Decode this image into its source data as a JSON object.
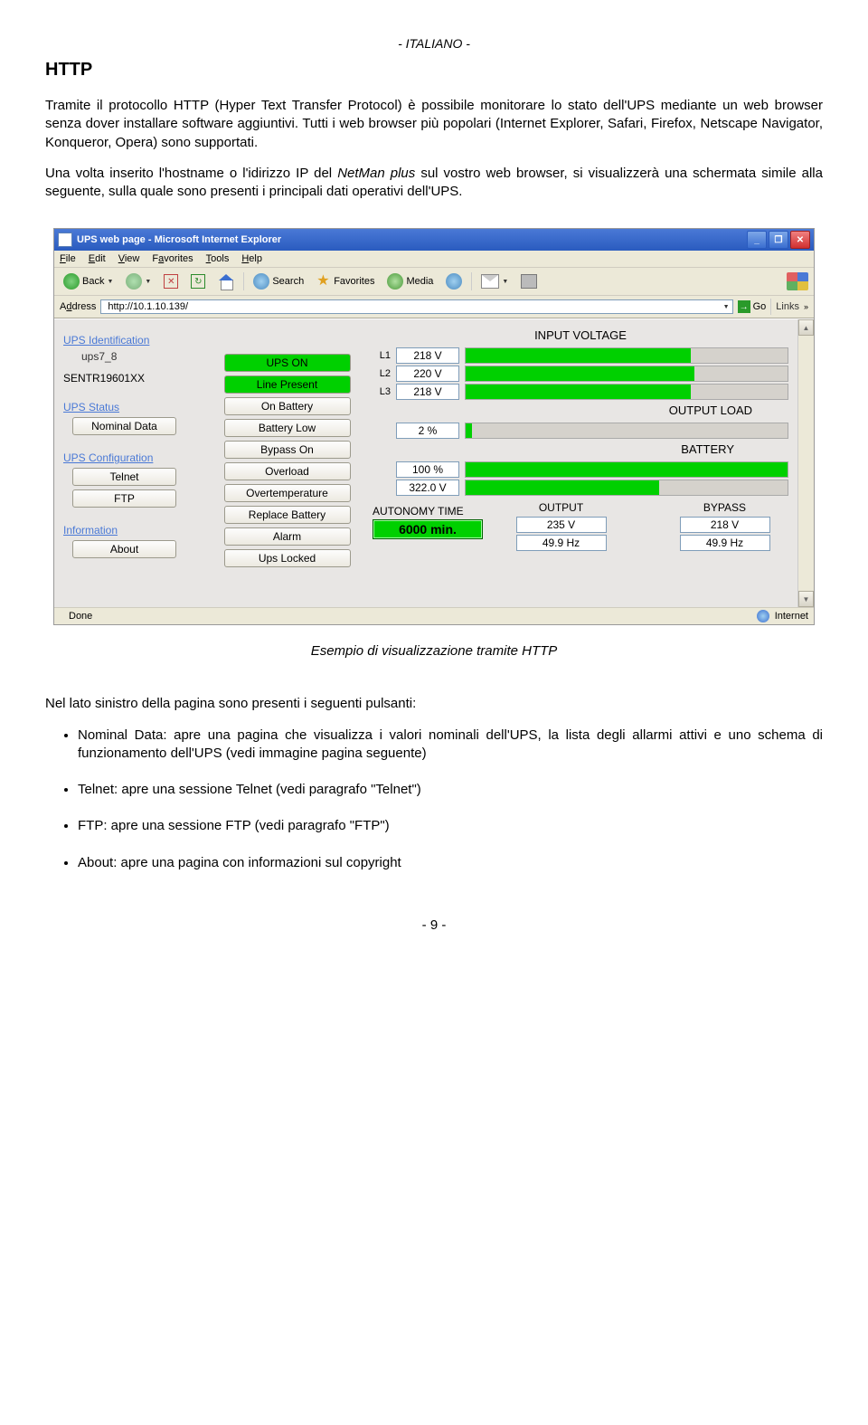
{
  "doc": {
    "lang_tag": "- ITALIANO -",
    "h1": "HTTP",
    "para1a": "Tramite il protocollo HTTP (Hyper Text Transfer Protocol) è possibile monitorare lo stato dell'UPS mediante un web browser senza dover installare software aggiuntivi. Tutti i web browser più popolari (Internet Explorer, Safari, Firefox, Netscape Navigator, Konqueror, Opera) sono supportati.",
    "para1b_a": "Una volta inserito l'hostname o l'idirizzo IP del ",
    "para1b_em": "NetMan plus",
    "para1b_b": " sul vostro web browser, si visualizzerà una schermata simile alla seguente, sulla quale sono presenti i principali dati operativi dell'UPS.",
    "caption": "Esempio di visualizzazione tramite HTTP",
    "para2": "Nel lato sinistro della pagina sono presenti i seguenti pulsanti:",
    "bul1": "Nominal Data: apre una pagina che visualizza i valori nominali dell'UPS, la lista degli allarmi attivi e uno schema di funzionamento dell'UPS (vedi immagine pagina seguente)",
    "bul2": "Telnet: apre una sessione Telnet (vedi paragrafo \"Telnet\")",
    "bul3": "FTP: apre una sessione FTP (vedi paragrafo \"FTP\")",
    "bul4": "About: apre una pagina con informazioni sul copyright",
    "pagenum": "- 9 -"
  },
  "shot": {
    "title": "UPS web page - Microsoft Internet Explorer",
    "menu": {
      "file": "File",
      "edit": "Edit",
      "view": "View",
      "favorites": "Favorites",
      "tools": "Tools",
      "help": "Help"
    },
    "tool": {
      "back": "Back",
      "search": "Search",
      "favorites": "Favorites",
      "media": "Media"
    },
    "addr": {
      "label": "Address",
      "url": "http://10.1.10.139/",
      "go": "Go",
      "links": "Links"
    },
    "left": {
      "id_hdr": "UPS Identification",
      "id_val": "ups7_8",
      "serial": "SENTR19601XX",
      "status_hdr": "UPS Status",
      "btn_nominal": "Nominal Data",
      "cfg_hdr": "UPS Configuration",
      "btn_telnet": "Telnet",
      "btn_ftp": "FTP",
      "info_hdr": "Information",
      "btn_about": "About"
    },
    "mid": {
      "items": [
        {
          "label": "UPS ON",
          "green": true
        },
        {
          "label": "Line Present",
          "green": true
        },
        {
          "label": "On Battery",
          "green": false
        },
        {
          "label": "Battery Low",
          "green": false
        },
        {
          "label": "Bypass On",
          "green": false
        },
        {
          "label": "Overload",
          "green": false
        },
        {
          "label": "Overtemperature",
          "green": false
        },
        {
          "label": "Replace Battery",
          "green": false
        },
        {
          "label": "Alarm",
          "green": false
        },
        {
          "label": "Ups Locked",
          "green": false
        }
      ]
    },
    "right": {
      "input_title": "INPUT VOLTAGE",
      "phases": [
        {
          "label": "L1",
          "value": "218 V",
          "pct": 70
        },
        {
          "label": "L2",
          "value": "220 V",
          "pct": 71
        },
        {
          "label": "L3",
          "value": "218 V",
          "pct": 70
        }
      ],
      "load_title": "OUTPUT LOAD",
      "load": {
        "value": "2 %",
        "pct": 2
      },
      "batt_title": "BATTERY",
      "batt_pct": {
        "value": "100 %",
        "pct": 100
      },
      "batt_v": {
        "value": "322.0 V",
        "pct": 60
      },
      "auton_title": "AUTONOMY TIME",
      "auton_val": "6000 min.",
      "output_title": "OUTPUT",
      "output_v": "235 V",
      "output_hz": "49.9 Hz",
      "bypass_title": "BYPASS",
      "bypass_v": "218 V",
      "bypass_hz": "49.9 Hz"
    },
    "status": {
      "done": "Done",
      "zone": "Internet"
    }
  }
}
